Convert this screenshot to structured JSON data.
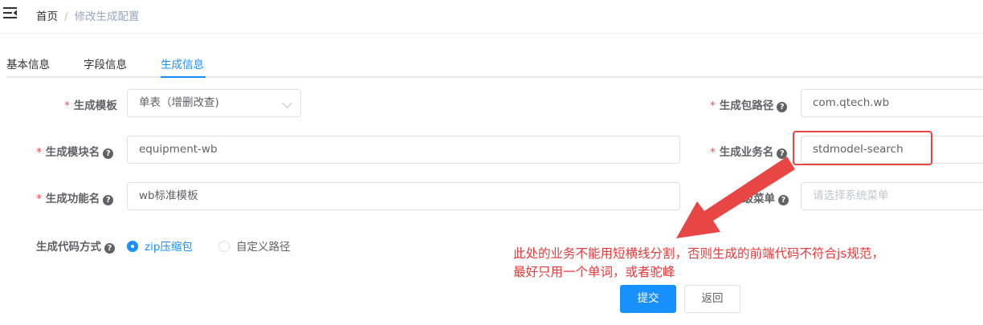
{
  "breadcrumb": {
    "home": "首页",
    "separator": "/",
    "current": "修改生成配置"
  },
  "tabs": [
    {
      "label": "基本信息",
      "active": false
    },
    {
      "label": "字段信息",
      "active": false
    },
    {
      "label": "生成信息",
      "active": true
    }
  ],
  "form": {
    "tpl_category": {
      "label": "生成模板",
      "required": "*",
      "value": "单表（增删改查)"
    },
    "package_name": {
      "label": "生成包路径",
      "required": "*",
      "value": "com.qtech.wb"
    },
    "module_name": {
      "label": "生成模块名",
      "required": "*",
      "value": "equipment-wb"
    },
    "business_name": {
      "label": "生成业务名",
      "required": "*",
      "value": "stdmodel-search"
    },
    "function_name": {
      "label": "生成功能名",
      "required": "*",
      "value": "wb标准模板"
    },
    "parent_menu": {
      "label": "上级菜单",
      "placeholder": "请选择系统菜单"
    },
    "gen_type": {
      "label": "生成代码方式",
      "options": [
        {
          "label": "zip压缩包",
          "checked": true
        },
        {
          "label": "自定义路径",
          "checked": false
        }
      ]
    },
    "help_icon": "?"
  },
  "annotation": {
    "line1": "此处的业务不能用短横线分割，否则生成的前端代码不符合js规范，",
    "line2": "最好只用一个单词，或者驼峰",
    "color": "#e83a3a"
  },
  "buttons": {
    "submit": "提交",
    "back": "返回"
  },
  "colors": {
    "primary": "#1890ff",
    "required": "#ff4949",
    "annotation": "#e84545"
  }
}
